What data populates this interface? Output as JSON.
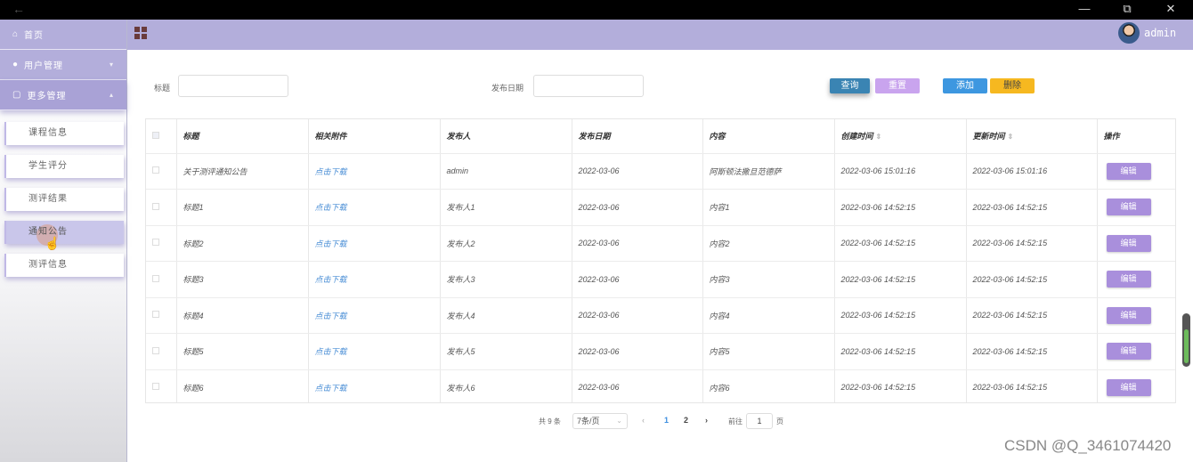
{
  "window": {
    "back_icon": "arrow-left-icon",
    "minimize": "—",
    "restore": "⧉",
    "close": "✕"
  },
  "header": {
    "user": "admin"
  },
  "sidebar": {
    "home": "首页",
    "user_mgmt": "用户管理",
    "more_mgmt": "更多管理",
    "items": [
      {
        "label": "课程信息"
      },
      {
        "label": "学生评分"
      },
      {
        "label": "测评结果"
      },
      {
        "label": "通知公告"
      },
      {
        "label": "测评信息"
      }
    ]
  },
  "search": {
    "title_label": "标题",
    "date_label": "发布日期",
    "query": "查询",
    "reset": "重置",
    "add": "添加",
    "delete": "删除"
  },
  "table": {
    "columns": [
      "标题",
      "相关附件",
      "发布人",
      "发布日期",
      "内容",
      "创建时间",
      "更新时间",
      "操作"
    ],
    "edit_label": "编辑",
    "rows": [
      {
        "title": "关于测评通知公告",
        "attach": "点击下载",
        "publisher": "admin",
        "date": "2022-03-06",
        "content": "阿斯顿法撒旦范德萨",
        "created": "2022-03-06 15:01:16",
        "updated": "2022-03-06 15:01:16"
      },
      {
        "title": "标题1",
        "attach": "点击下载",
        "publisher": "发布人1",
        "date": "2022-03-06",
        "content": "内容1",
        "created": "2022-03-06 14:52:15",
        "updated": "2022-03-06 14:52:15"
      },
      {
        "title": "标题2",
        "attach": "点击下载",
        "publisher": "发布人2",
        "date": "2022-03-06",
        "content": "内容2",
        "created": "2022-03-06 14:52:15",
        "updated": "2022-03-06 14:52:15"
      },
      {
        "title": "标题3",
        "attach": "点击下载",
        "publisher": "发布人3",
        "date": "2022-03-06",
        "content": "内容3",
        "created": "2022-03-06 14:52:15",
        "updated": "2022-03-06 14:52:15"
      },
      {
        "title": "标题4",
        "attach": "点击下载",
        "publisher": "发布人4",
        "date": "2022-03-06",
        "content": "内容4",
        "created": "2022-03-06 14:52:15",
        "updated": "2022-03-06 14:52:15"
      },
      {
        "title": "标题5",
        "attach": "点击下载",
        "publisher": "发布人5",
        "date": "2022-03-06",
        "content": "内容5",
        "created": "2022-03-06 14:52:15",
        "updated": "2022-03-06 14:52:15"
      },
      {
        "title": "标题6",
        "attach": "点击下载",
        "publisher": "发布人6",
        "date": "2022-03-06",
        "content": "内容6",
        "created": "2022-03-06 14:52:15",
        "updated": "2022-03-06 14:52:15"
      }
    ]
  },
  "pagination": {
    "total": "共 9 条",
    "page_size": "7条/页",
    "prev": "‹",
    "page1": "1",
    "page2": "2",
    "next": "›",
    "goto": "前往",
    "current": "1",
    "page_unit": "页"
  },
  "watermark": "CSDN @Q_3461074420"
}
